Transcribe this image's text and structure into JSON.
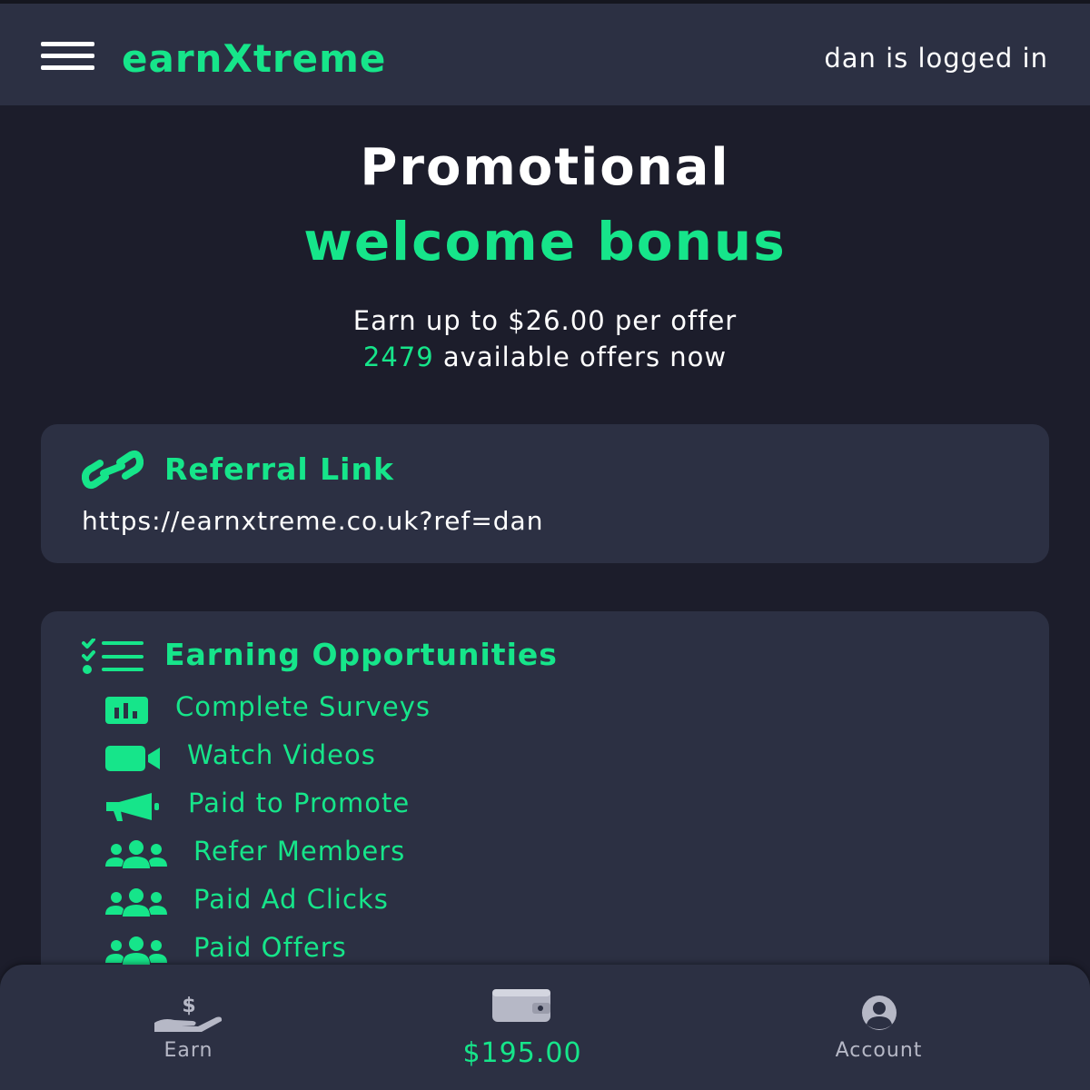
{
  "header": {
    "brand": "earnXtreme",
    "logged_in_text": "dan is logged in"
  },
  "hero": {
    "title": "Promotional",
    "subtitle": "welcome bonus",
    "earn_line": "Earn up to $26.00 per offer",
    "offers_count": "2479",
    "offers_suffix": " available offers now"
  },
  "referral": {
    "icon": "link-icon",
    "title": "Referral Link",
    "url": "https://earnxtreme.co.uk?ref=dan"
  },
  "earning": {
    "icon": "checklist-icon",
    "title": "Earning Opportunities",
    "items": [
      {
        "label": "Complete Surveys",
        "icon": "chart-bar-icon"
      },
      {
        "label": "Watch Videos",
        "icon": "video-camera-icon"
      },
      {
        "label": "Paid to Promote",
        "icon": "megaphone-icon"
      },
      {
        "label": "Refer Members",
        "icon": "users-icon"
      },
      {
        "label": "Paid Ad Clicks",
        "icon": "users-icon"
      },
      {
        "label": "Paid Offers",
        "icon": "users-icon"
      }
    ]
  },
  "bottom_nav": {
    "earn_label": "Earn",
    "earn_icon": "hand-dollar-icon",
    "balance": "$195.00",
    "balance_icon": "wallet-icon",
    "account_label": "Account",
    "account_icon": "user-circle-icon"
  },
  "colors": {
    "accent": "#16e58a",
    "background": "#1c1d2b",
    "card": "#2c3043",
    "muted": "#b6b8c6"
  }
}
